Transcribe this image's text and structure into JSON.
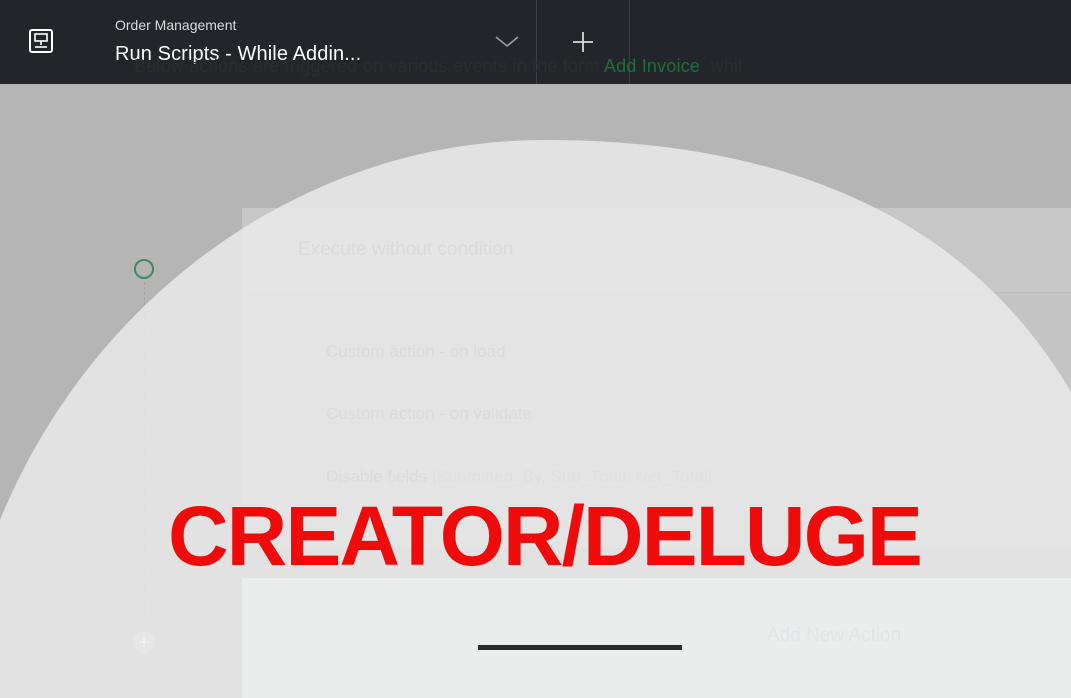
{
  "header": {
    "app_icon": "app-window-icon",
    "subtitle": "Order Management",
    "title": "Run Scripts - While Addin...",
    "dropdown_icon": "chevron-down-icon",
    "add_icon": "plus-icon"
  },
  "main": {
    "intro_prefix": "Below actions are triggered on various events in the form ",
    "intro_link": "Add Invoice",
    "intro_suffix": ", whil",
    "card": {
      "header_label": "Execute without condition",
      "items": [
        "Custom action - on load",
        "Custom action - on validate"
      ],
      "disable_prefix": "Disable fields ",
      "disable_fields": "[Submitted_By, Sub_Total, Net_Total]"
    },
    "add_action_label": "Add New Action"
  },
  "overlay": {
    "watermark": "CREATOR/DELUGE"
  },
  "colors": {
    "topbar": "#23252b",
    "link": "#1f6e3c",
    "watermark": "#f00b0b",
    "timeline_dot": "#3d8a64"
  }
}
